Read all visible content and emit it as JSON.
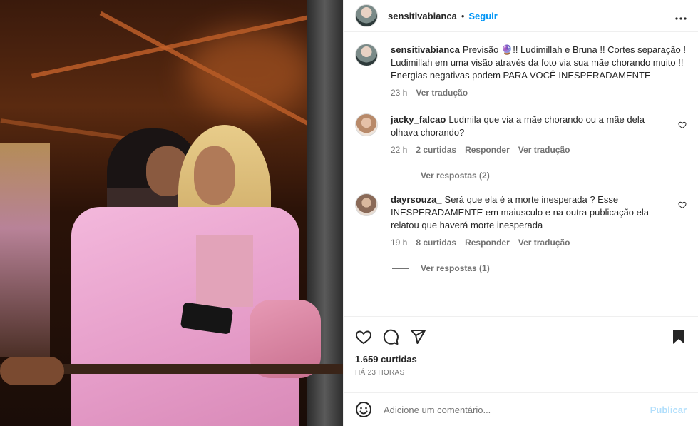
{
  "post": {
    "username": "sensitivabianca",
    "follow_label": "Seguir",
    "dot": "•"
  },
  "caption": {
    "username": "sensitivabianca",
    "text": "Previsão 🔮!! Ludimillah e Bruna !! Cortes separação ! Ludimillah em uma visão através da foto via sua mãe chorando muito !! Energias negativas podem PARA VOCÊ INESPERADAMENTE",
    "time": "23 h",
    "translate": "Ver tradução"
  },
  "comments": [
    {
      "username": "jacky_falcao",
      "text": "Ludmila que via a mãe chorando ou a mãe dela olhava chorando?",
      "time": "22 h",
      "likes": "2 curtidas",
      "reply": "Responder",
      "translate": "Ver tradução",
      "replies": "Ver respostas (2)"
    },
    {
      "username": "dayrsouza_",
      "text": "Será que ela é a morte inesperada ? Esse INESPERADAMENTE em maiusculo e na outra publicação ela relatou que haverá morte inesperada",
      "time": "19 h",
      "likes": "8 curtidas",
      "reply": "Responder",
      "translate": "Ver tradução",
      "replies": "Ver respostas (1)"
    }
  ],
  "footer": {
    "likes": "1.659 curtidas",
    "date": "HÁ 23 HORAS",
    "comment_placeholder": "Adicione um comentário...",
    "publish": "Publicar"
  },
  "icons": {
    "like": "heart-icon",
    "comment": "comment-icon",
    "share": "share-icon",
    "save": "bookmark-icon",
    "emoji": "emoji-icon",
    "more": "more-icon"
  }
}
